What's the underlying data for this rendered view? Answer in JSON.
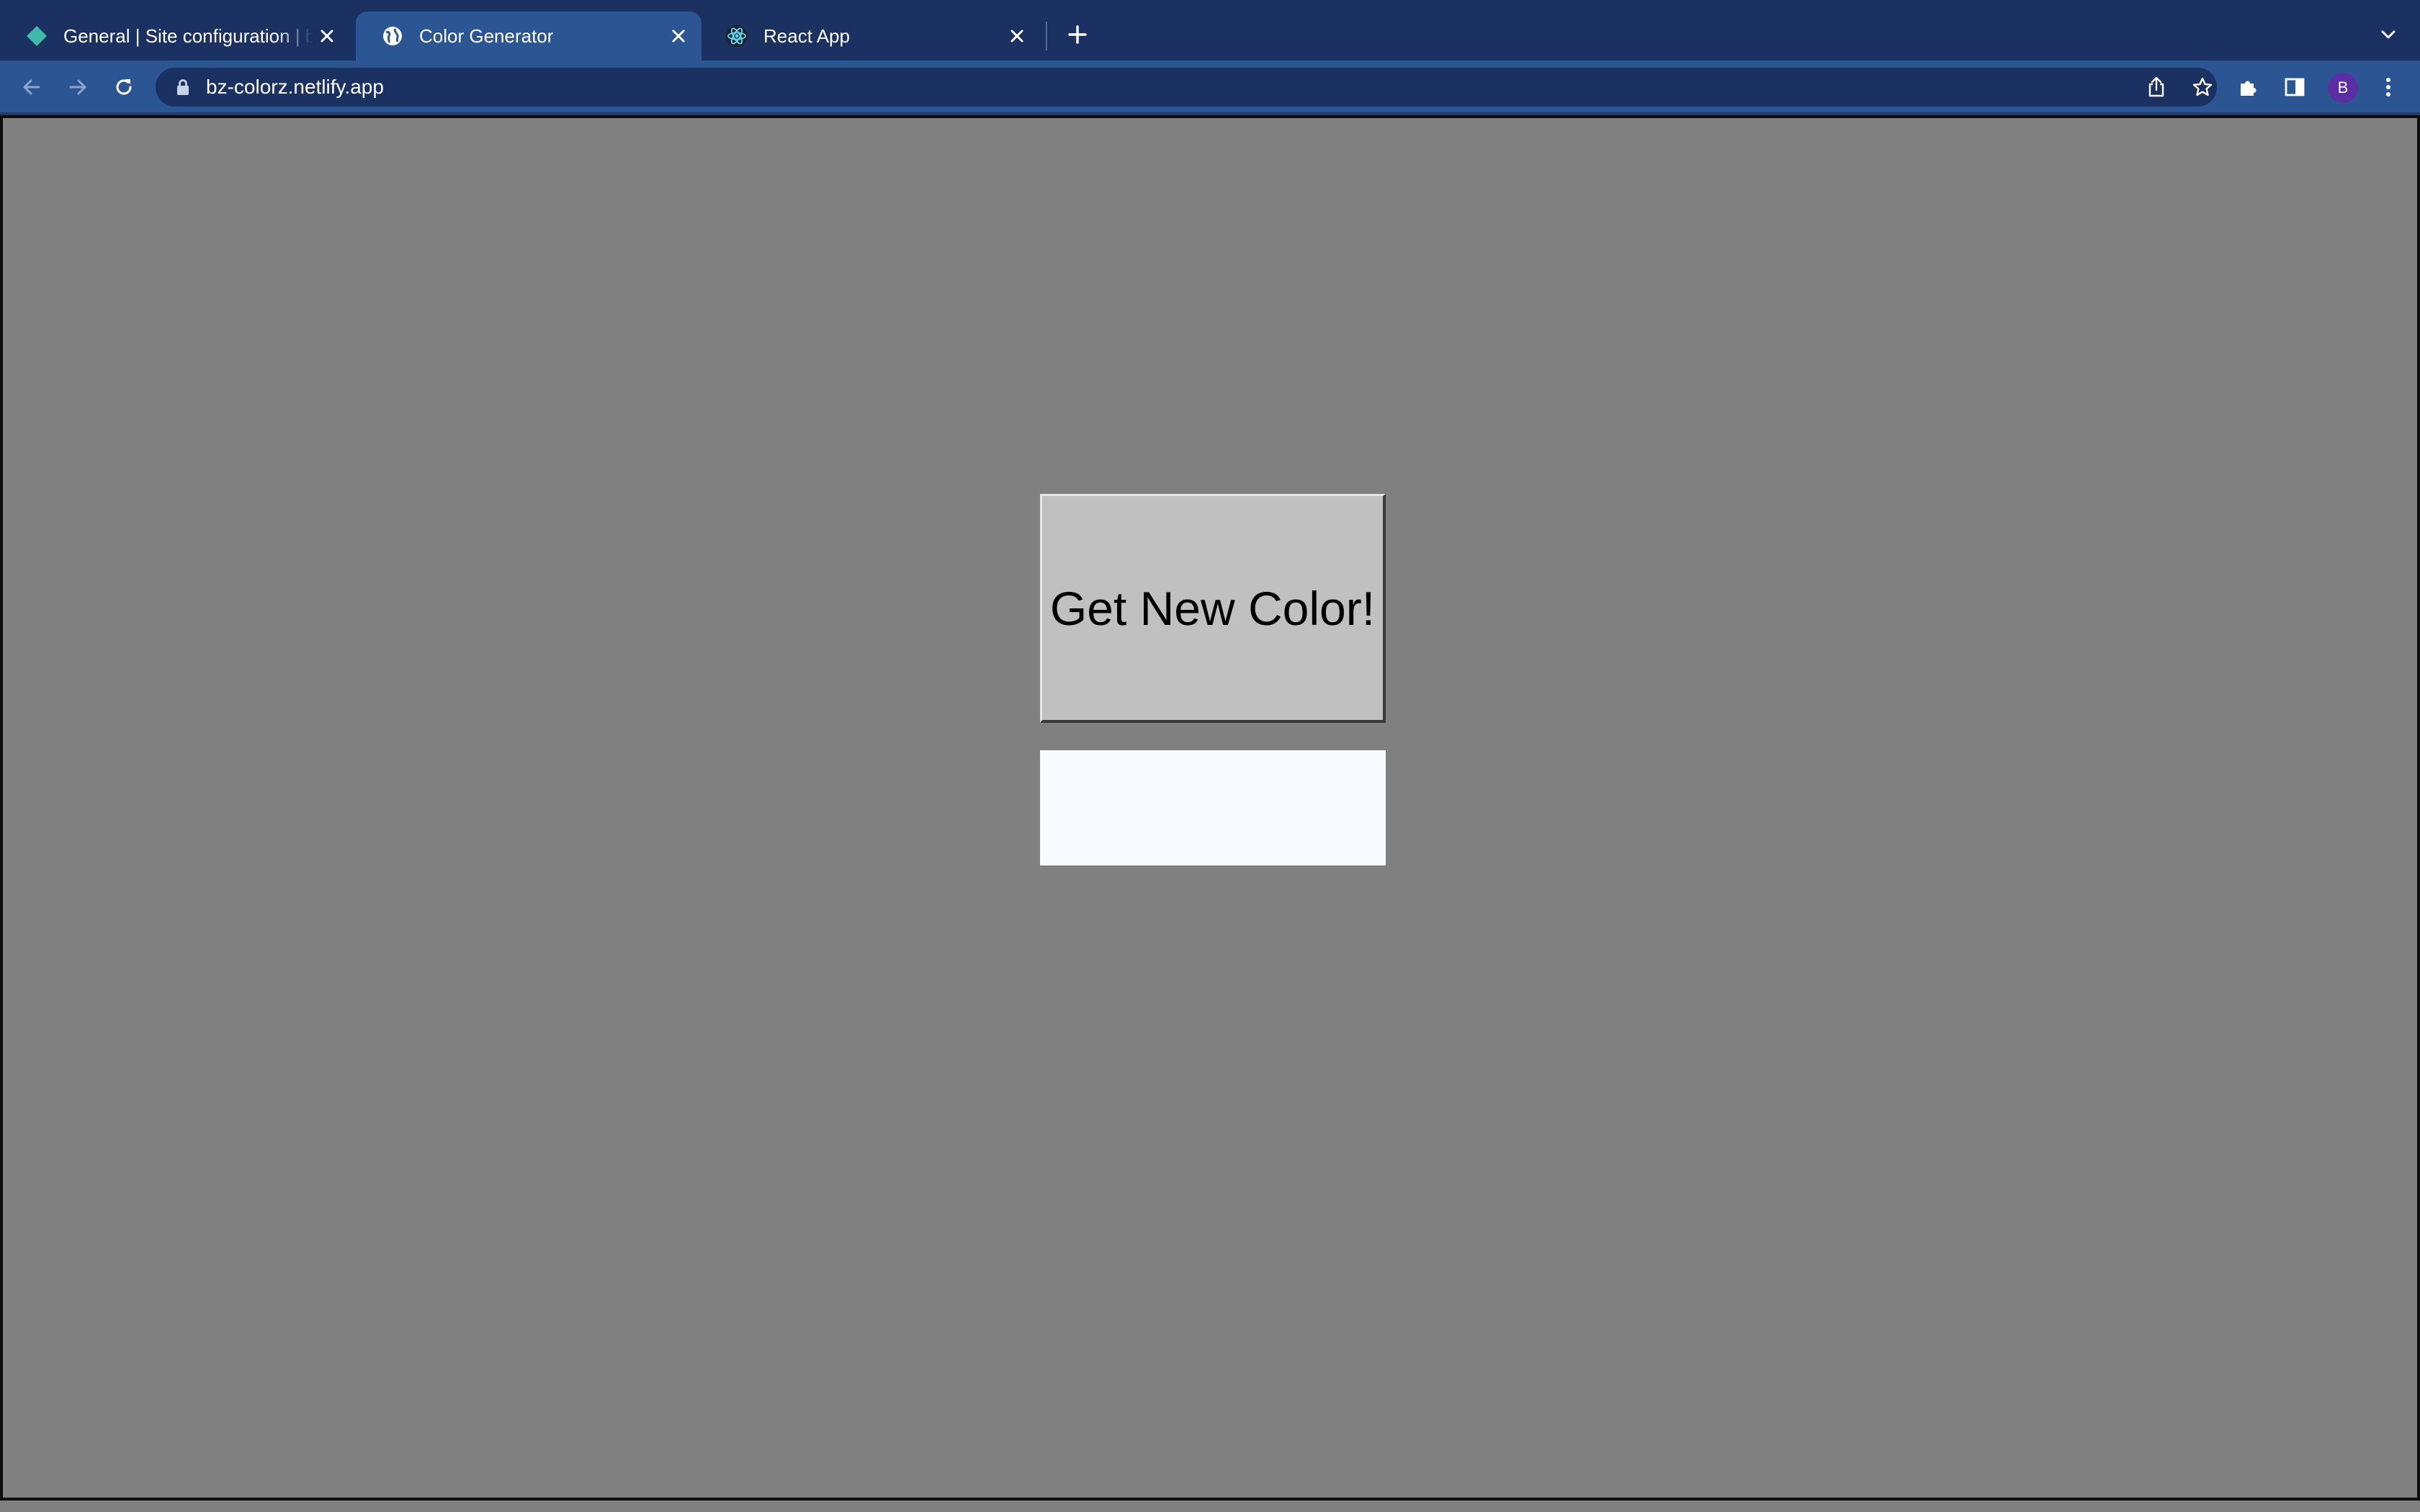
{
  "browser": {
    "tabs": [
      {
        "title": "General | Site configuration | bz-colorz",
        "favicon": "netlify-diamond-icon",
        "active": false
      },
      {
        "title": "Color Generator",
        "favicon": "globe-icon",
        "active": true
      },
      {
        "title": "React App",
        "favicon": "react-atom-icon",
        "active": false
      }
    ],
    "address_bar": {
      "url": "bz-colorz.netlify.app"
    },
    "profile_initial": "B"
  },
  "page": {
    "button_label": "Get New Color!",
    "swatch_color": "#f8f8ff",
    "background_color": "#808080"
  },
  "colors": {
    "tabstrip": "#1a3161",
    "toolbar": "#2b5593",
    "avatar": "#5b2ea6"
  }
}
